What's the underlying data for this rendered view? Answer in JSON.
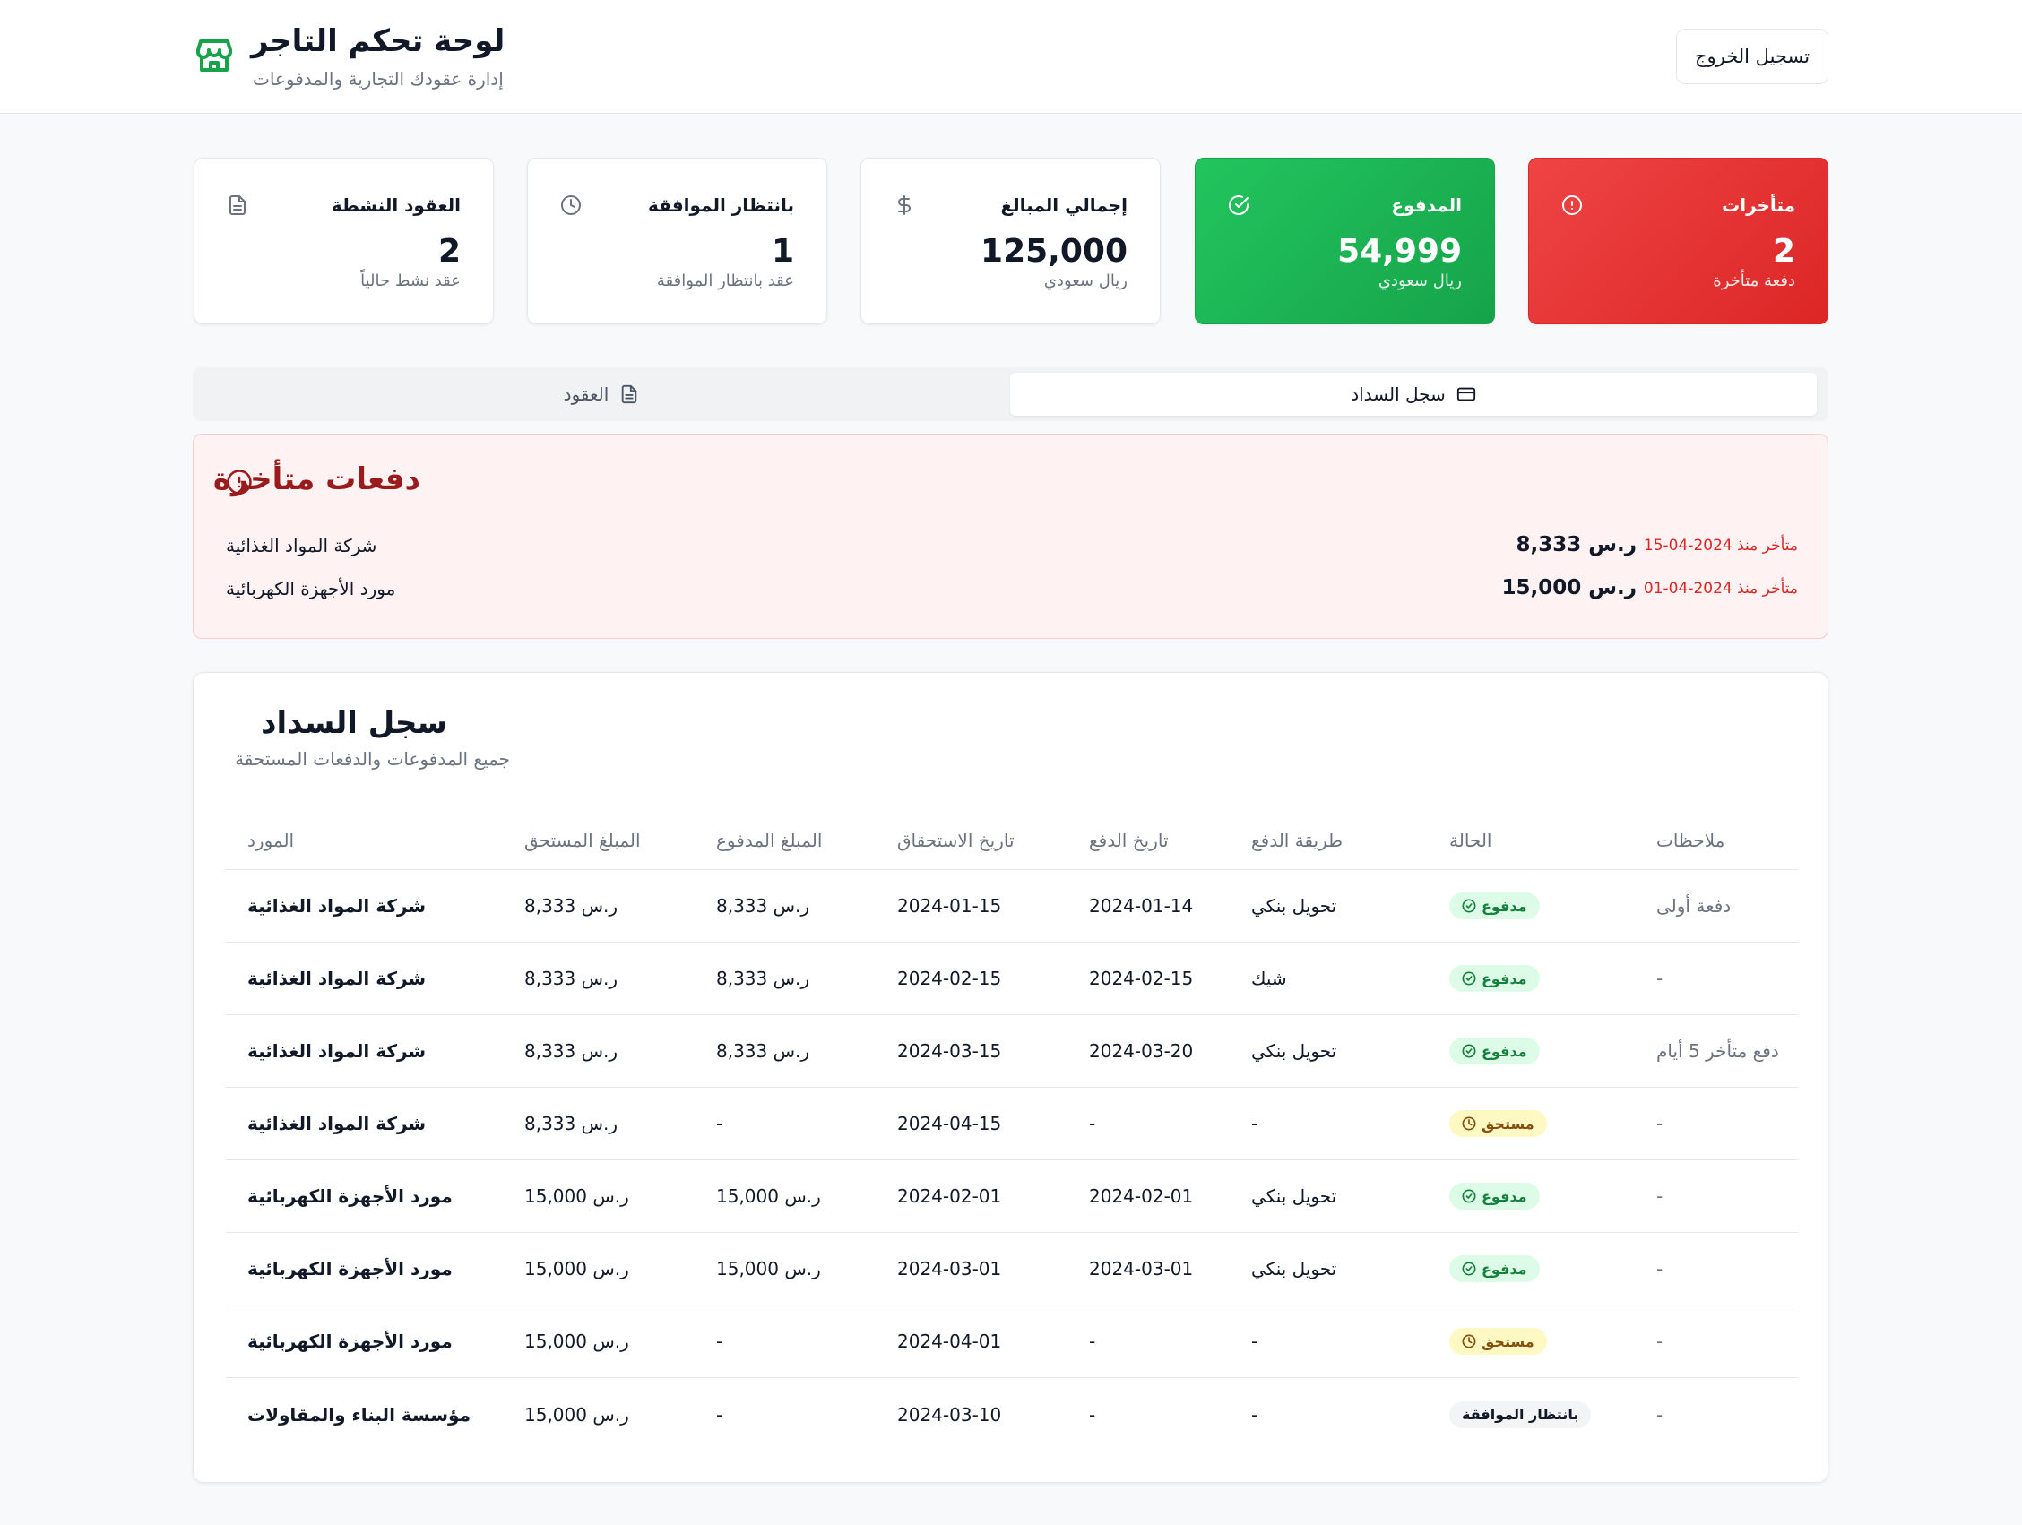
{
  "header": {
    "title": "لوحة تحكم التاجر",
    "subtitle": "إدارة عقودك التجارية والمدفوعات",
    "logout_label": "تسجيل الخروج",
    "accent_color": "#16a34a"
  },
  "stats": [
    {
      "title": "العقود النشطة",
      "value": "2",
      "desc": "عقد نشط حالياً",
      "icon": "file-icon"
    },
    {
      "title": "بانتظار الموافقة",
      "value": "1",
      "desc": "عقد بانتظار الموافقة",
      "icon": "clock-icon"
    },
    {
      "title": "إجمالي المبالغ",
      "value": "125,000",
      "desc": "ريال سعودي",
      "icon": "dollar-icon"
    },
    {
      "title": "المدفوع",
      "value": "54,999",
      "desc": "ريال سعودي",
      "icon": "check-circle-icon",
      "color": "#22c55e"
    },
    {
      "title": "متأخرات",
      "value": "2",
      "desc": "دفعة متأخرة",
      "icon": "alert-circle-icon",
      "color": "#ef4444"
    }
  ],
  "tabs": [
    {
      "label": "سجل السداد",
      "icon": "credit-card-icon",
      "active": true
    },
    {
      "label": "العقود",
      "icon": "file-icon",
      "active": false
    }
  ],
  "overdue": {
    "title": "دفعات متأخرة",
    "items": [
      {
        "supplier": "شركة المواد الغذائية",
        "amount": "8,333 ر.س",
        "since": "متأخر منذ 2024-04-15"
      },
      {
        "supplier": "مورد الأجهزة الكهربائية",
        "amount": "15,000 ر.س",
        "since": "متأخر منذ 2024-04-01"
      }
    ]
  },
  "ledger": {
    "title": "سجل السداد",
    "subtitle": "جميع المدفوعات والدفعات المستحقة",
    "columns": {
      "supplier": "المورد",
      "amount_due": "المبلغ المستحق",
      "amount_paid": "المبلغ المدفوع",
      "due_date": "تاريخ الاستحقاق",
      "pay_date": "تاريخ الدفع",
      "method": "طريقة الدفع",
      "status": "الحالة",
      "notes": "ملاحظات"
    },
    "rows": [
      {
        "supplier": "شركة المواد الغذائية",
        "amount_due": "8,333 ر.س",
        "amount_paid": "8,333 ر.س",
        "due_date": "2024-01-15",
        "pay_date": "2024-01-14",
        "method": "تحويل بنكي",
        "status": "مدفوع",
        "status_type": "paid",
        "notes": "دفعة أولى"
      },
      {
        "supplier": "شركة المواد الغذائية",
        "amount_due": "8,333 ر.س",
        "amount_paid": "8,333 ر.س",
        "due_date": "2024-02-15",
        "pay_date": "2024-02-15",
        "method": "شيك",
        "status": "مدفوع",
        "status_type": "paid",
        "notes": "-"
      },
      {
        "supplier": "شركة المواد الغذائية",
        "amount_due": "8,333 ر.س",
        "amount_paid": "8,333 ر.س",
        "due_date": "2024-03-15",
        "pay_date": "2024-03-20",
        "method": "تحويل بنكي",
        "status": "مدفوع",
        "status_type": "paid",
        "notes": "دفع متأخر 5 أيام"
      },
      {
        "supplier": "شركة المواد الغذائية",
        "amount_due": "8,333 ر.س",
        "amount_paid": "-",
        "due_date": "2024-04-15",
        "pay_date": "-",
        "method": "-",
        "status": "مستحق",
        "status_type": "due",
        "notes": "-"
      },
      {
        "supplier": "مورد الأجهزة الكهربائية",
        "amount_due": "15,000 ر.س",
        "amount_paid": "15,000 ر.س",
        "due_date": "2024-02-01",
        "pay_date": "2024-02-01",
        "method": "تحويل بنكي",
        "status": "مدفوع",
        "status_type": "paid",
        "notes": "-"
      },
      {
        "supplier": "مورد الأجهزة الكهربائية",
        "amount_due": "15,000 ر.س",
        "amount_paid": "15,000 ر.س",
        "due_date": "2024-03-01",
        "pay_date": "2024-03-01",
        "method": "تحويل بنكي",
        "status": "مدفوع",
        "status_type": "paid",
        "notes": "-"
      },
      {
        "supplier": "مورد الأجهزة الكهربائية",
        "amount_due": "15,000 ر.س",
        "amount_paid": "-",
        "due_date": "2024-04-01",
        "pay_date": "-",
        "method": "-",
        "status": "مستحق",
        "status_type": "due",
        "notes": "-"
      },
      {
        "supplier": "مؤسسة البناء والمقاولات",
        "amount_due": "15,000 ر.س",
        "amount_paid": "-",
        "due_date": "2024-03-10",
        "pay_date": "-",
        "method": "-",
        "status": "بانتظار الموافقة",
        "status_type": "pending",
        "notes": "-"
      }
    ]
  }
}
